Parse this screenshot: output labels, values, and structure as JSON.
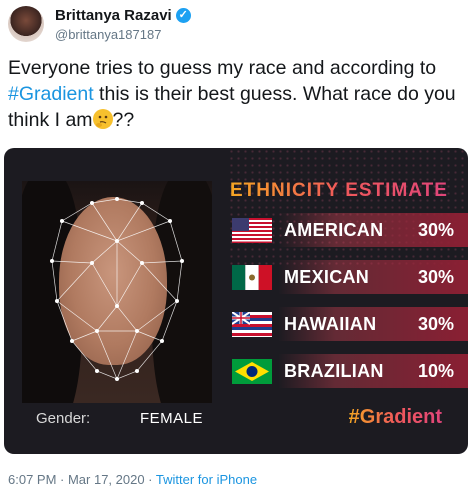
{
  "author": {
    "display_name": "Brittanya Razavi",
    "handle": "@brittanya187187",
    "verified_icon": "verified-badge-icon"
  },
  "tweet": {
    "text_before_hashtag": "Everyone tries to guess my race and according to ",
    "hashtag": "#Gradient",
    "text_after_hashtag": " this is their best guess. What race do you think I am",
    "emoji": "thinking-face-icon",
    "text_end": "??"
  },
  "card": {
    "title": "ETHNICITY ESTIMATE",
    "gender_label": "Gender:",
    "gender_value": "FEMALE",
    "hashtag": "#Gradient",
    "estimates": [
      {
        "country": "AMERICAN",
        "percent": "30%",
        "flag": "usa-flag-icon"
      },
      {
        "country": "MEXICAN",
        "percent": "30%",
        "flag": "mexico-flag-icon"
      },
      {
        "country": "HAWAIIAN",
        "percent": "30%",
        "flag": "hawaii-flag-icon"
      },
      {
        "country": "BRAZILIAN",
        "percent": "10%",
        "flag": "brazil-flag-icon"
      }
    ],
    "colors": {
      "accent_start": "#f5a623",
      "accent_end": "#e0457a",
      "bar": "#8a1f33",
      "background": "#1c1b21"
    }
  },
  "meta": {
    "timestamp": "6:07 PM · Mar 17, 2020 · ",
    "source": "Twitter for iPhone"
  }
}
